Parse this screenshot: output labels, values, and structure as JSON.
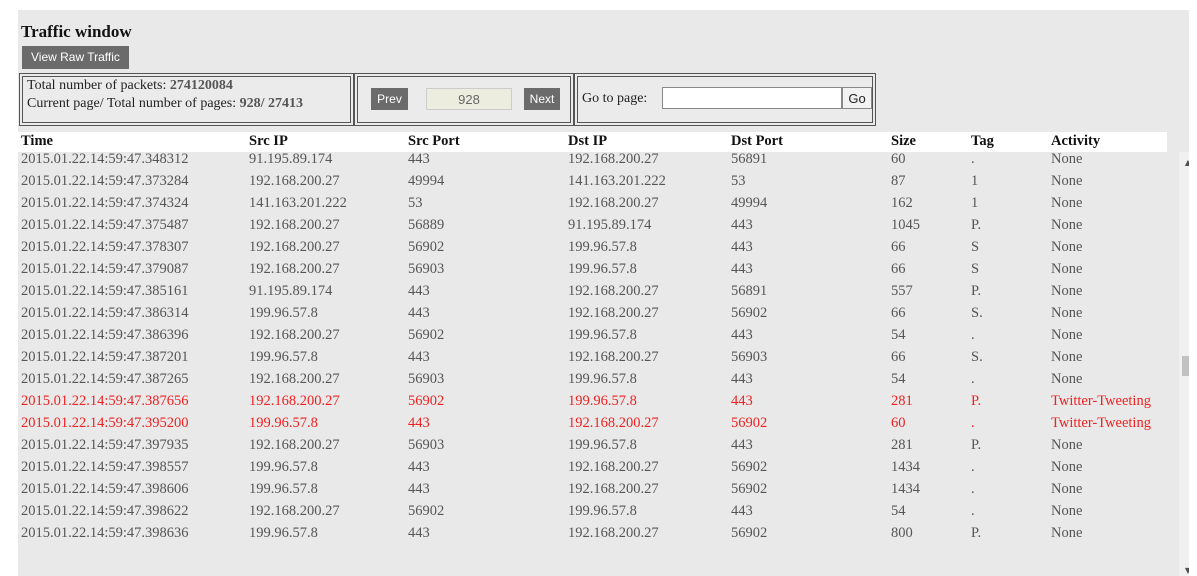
{
  "window": {
    "title": "Traffic window",
    "raw_button_label": "View Raw Traffic"
  },
  "stats": {
    "total_packets_label": "Total number of packets:",
    "total_packets_value": "274120084",
    "pages_label": "Current page/ Total number of pages:",
    "pages_value": "928/ 27413"
  },
  "pager": {
    "prev_label": "Prev",
    "current_page": "928",
    "next_label": "Next"
  },
  "goto": {
    "label": "Go to page:",
    "value": "",
    "button_label": "Go"
  },
  "columns": [
    "Time",
    "Src IP",
    "Src Port",
    "Dst IP",
    "Dst Port",
    "Size",
    "Tag",
    "Activity"
  ],
  "rows": [
    [
      "2015.01.22.14:59:47.348312",
      "91.195.89.174",
      "443",
      "192.168.200.27",
      "56891",
      "60",
      ".",
      "None"
    ],
    [
      "2015.01.22.14:59:47.373284",
      "192.168.200.27",
      "49994",
      "141.163.201.222",
      "53",
      "87",
      "1",
      "None"
    ],
    [
      "2015.01.22.14:59:47.374324",
      "141.163.201.222",
      "53",
      "192.168.200.27",
      "49994",
      "162",
      "1",
      "None"
    ],
    [
      "2015.01.22.14:59:47.375487",
      "192.168.200.27",
      "56889",
      "91.195.89.174",
      "443",
      "1045",
      "P.",
      "None"
    ],
    [
      "2015.01.22.14:59:47.378307",
      "192.168.200.27",
      "56902",
      "199.96.57.8",
      "443",
      "66",
      "S",
      "None"
    ],
    [
      "2015.01.22.14:59:47.379087",
      "192.168.200.27",
      "56903",
      "199.96.57.8",
      "443",
      "66",
      "S",
      "None"
    ],
    [
      "2015.01.22.14:59:47.385161",
      "91.195.89.174",
      "443",
      "192.168.200.27",
      "56891",
      "557",
      "P.",
      "None"
    ],
    [
      "2015.01.22.14:59:47.386314",
      "199.96.57.8",
      "443",
      "192.168.200.27",
      "56902",
      "66",
      "S.",
      "None"
    ],
    [
      "2015.01.22.14:59:47.386396",
      "192.168.200.27",
      "56902",
      "199.96.57.8",
      "443",
      "54",
      ".",
      "None"
    ],
    [
      "2015.01.22.14:59:47.387201",
      "199.96.57.8",
      "443",
      "192.168.200.27",
      "56903",
      "66",
      "S.",
      "None"
    ],
    [
      "2015.01.22.14:59:47.387265",
      "192.168.200.27",
      "56903",
      "199.96.57.8",
      "443",
      "54",
      ".",
      "None"
    ],
    [
      "2015.01.22.14:59:47.387656",
      "192.168.200.27",
      "56902",
      "199.96.57.8",
      "443",
      "281",
      "P.",
      "Twitter-Tweeting"
    ],
    [
      "2015.01.22.14:59:47.395200",
      "199.96.57.8",
      "443",
      "192.168.200.27",
      "56902",
      "60",
      ".",
      "Twitter-Tweeting"
    ],
    [
      "2015.01.22.14:59:47.397935",
      "192.168.200.27",
      "56903",
      "199.96.57.8",
      "443",
      "281",
      "P.",
      "None"
    ],
    [
      "2015.01.22.14:59:47.398557",
      "199.96.57.8",
      "443",
      "192.168.200.27",
      "56902",
      "1434",
      ".",
      "None"
    ],
    [
      "2015.01.22.14:59:47.398606",
      "199.96.57.8",
      "443",
      "192.168.200.27",
      "56902",
      "1434",
      ".",
      "None"
    ],
    [
      "2015.01.22.14:59:47.398622",
      "192.168.200.27",
      "56902",
      "199.96.57.8",
      "443",
      "54",
      ".",
      "None"
    ],
    [
      "2015.01.22.14:59:47.398636",
      "199.96.57.8",
      "443",
      "192.168.200.27",
      "56902",
      "800",
      "P.",
      "None"
    ]
  ],
  "highlight_color": "#ee2222",
  "scrollbar": {
    "up_icon": "triangle-up",
    "down_icon": "triangle-down"
  }
}
